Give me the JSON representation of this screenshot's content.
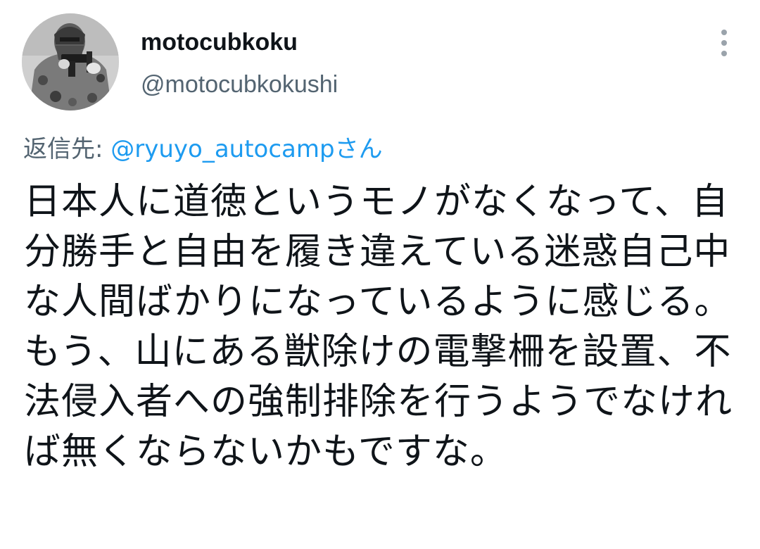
{
  "tweet": {
    "author": {
      "display_name": "motocubkoku",
      "handle": "@motocubkokushi",
      "avatar_icon": "profile-photo-masked-person"
    },
    "more_icon": "vertical-ellipsis-icon",
    "reply_context": {
      "prefix": "返信先",
      "separator": ": ",
      "handle": "@ryuyo_autocamp",
      "suffix": "さん"
    },
    "text": "日本人に道徳というモノがなくなって、自分勝手と自由を履き違えている迷惑自己中な人間ばかりになっているように感じる。もう、山にある獣除けの電撃柵を設置、不法侵入者への強制排除を行うようでなければ無くならないかもですな。"
  },
  "colors": {
    "text_primary": "#0f1419",
    "text_secondary": "#536471",
    "link": "#1d9bf0",
    "background": "#ffffff"
  }
}
